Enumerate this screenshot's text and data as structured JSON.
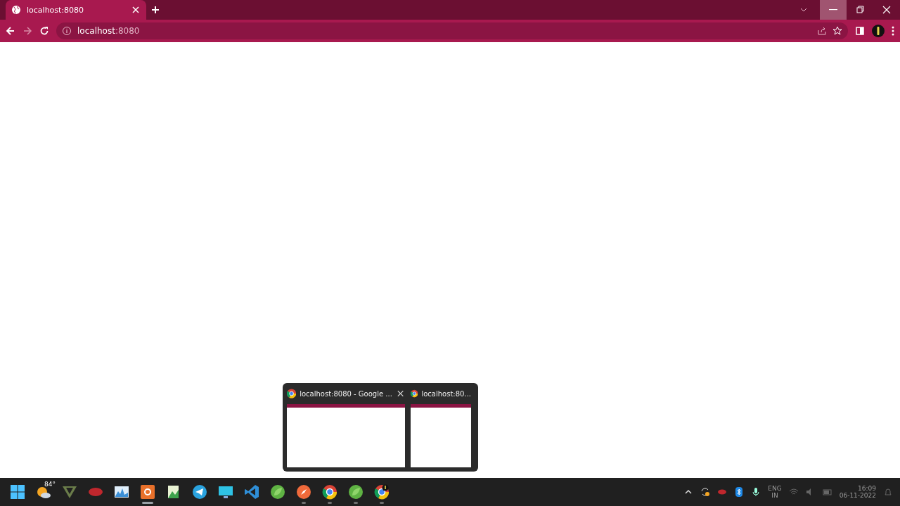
{
  "browser": {
    "tabs": [
      {
        "title": "localhost:8080",
        "selected": true
      }
    ],
    "address": {
      "host": "localhost",
      "port": ":8080"
    }
  },
  "taskbar": {
    "weather": "84°",
    "apps": [
      {
        "kind": "start",
        "running": false,
        "active": false
      },
      {
        "kind": "weather",
        "running": false,
        "active": false
      },
      {
        "kind": "vlogo",
        "running": false,
        "active": false
      },
      {
        "kind": "redapp",
        "running": false,
        "active": false
      },
      {
        "kind": "monitor",
        "running": false,
        "active": false
      },
      {
        "kind": "recorder",
        "running": true,
        "active": true
      },
      {
        "kind": "notepad",
        "running": false,
        "active": false
      },
      {
        "kind": "telegram",
        "running": false,
        "active": false
      },
      {
        "kind": "desktop",
        "running": false,
        "active": false
      },
      {
        "kind": "vscode",
        "running": false,
        "active": false
      },
      {
        "kind": "spring",
        "running": false,
        "active": false
      },
      {
        "kind": "compass",
        "running": true,
        "active": false
      },
      {
        "kind": "chrome",
        "running": true,
        "active": false
      },
      {
        "kind": "spring",
        "running": true,
        "active": false
      },
      {
        "kind": "chromebadge",
        "running": true,
        "active": false
      }
    ],
    "tray": {
      "language": "ENG",
      "region": "IN",
      "time": "16:09",
      "date": "06-11-2022"
    }
  },
  "preview": [
    {
      "title": "localhost:8080 - Google ...",
      "closable": true
    },
    {
      "title": "localhost:80...",
      "closable": false
    }
  ]
}
